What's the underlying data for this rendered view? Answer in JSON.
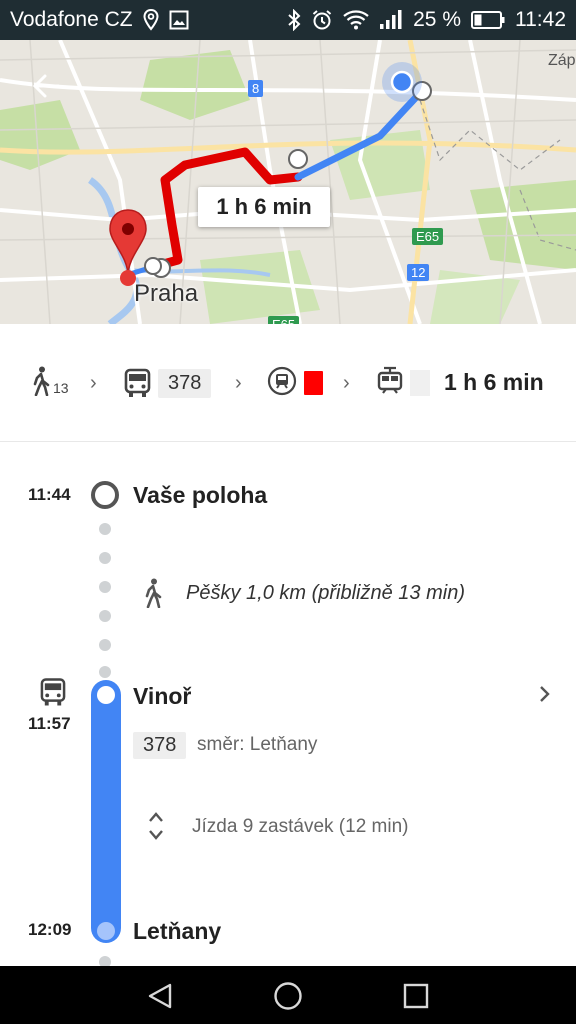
{
  "status_bar": {
    "carrier": "Vodafone CZ",
    "battery": "25 %",
    "time": "11:42",
    "icons": [
      "location-icon",
      "gallery-icon",
      "bluetooth-icon",
      "alarm-icon",
      "wifi-icon",
      "signal-icon",
      "battery-icon"
    ]
  },
  "map": {
    "city_label": "Praha",
    "edge_label": "Záp",
    "duration_bubble": "1 h 6 min",
    "road_badges": [
      "8",
      "E65",
      "12",
      "E65"
    ],
    "colors": {
      "walk_route": "#4285f4",
      "transit_route": "#e00000",
      "water": "#a7c8f0",
      "park": "#c6dfa5"
    }
  },
  "summary": {
    "walk_minutes": "13",
    "bus_line": "378",
    "duration": "1 h 6 min",
    "metro_line_color": "#ff0000"
  },
  "timeline": {
    "start": {
      "time": "11:44",
      "name": "Vaše poloha"
    },
    "walk": {
      "text": "Pěšky 1,0 km (přibližně 13 min)"
    },
    "board": {
      "time": "11:57",
      "name": "Vinoř",
      "line": "378",
      "direction": "směr: Letňany"
    },
    "ride": {
      "text": "Jízda 9 zastávek (12 min)"
    },
    "alight": {
      "time": "12:09",
      "name": "Letňany"
    },
    "colors": {
      "bus_line": "#4285f4"
    }
  },
  "nav_bar": {
    "buttons": [
      "back-nav-icon",
      "home-nav-icon",
      "recents-nav-icon"
    ]
  }
}
